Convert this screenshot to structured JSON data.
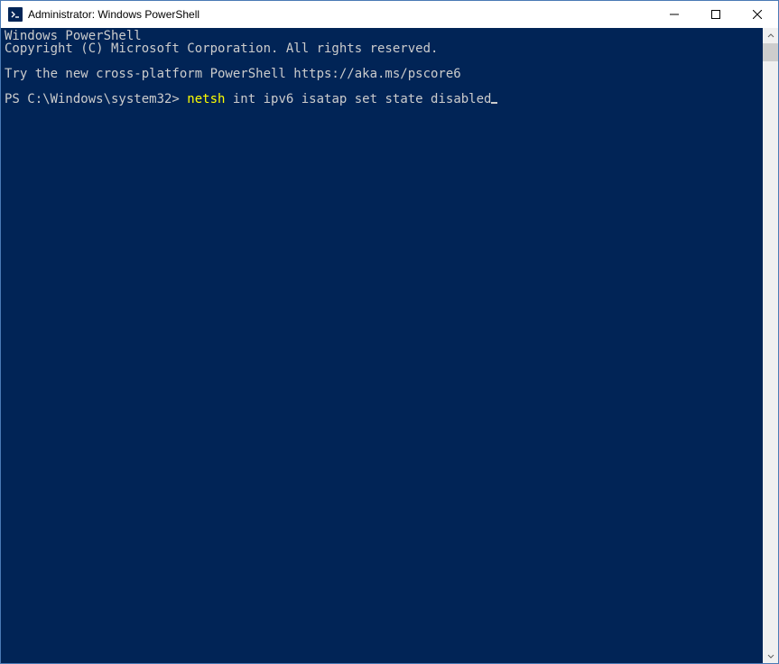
{
  "titlebar": {
    "title": "Administrator: Windows PowerShell",
    "icon_name": "powershell-icon"
  },
  "terminal": {
    "header_line1": "Windows PowerShell",
    "header_line2": "Copyright (C) Microsoft Corporation. All rights reserved.",
    "hint_line": "Try the new cross-platform PowerShell https://aka.ms/pscore6",
    "prompt": "PS C:\\Windows\\system32> ",
    "command_highlight": "netsh",
    "command_rest": " int ipv6 isatap set state disabled"
  },
  "colors": {
    "terminal_bg": "#012456",
    "terminal_fg": "#cccccc",
    "command_color": "#ffff00"
  }
}
